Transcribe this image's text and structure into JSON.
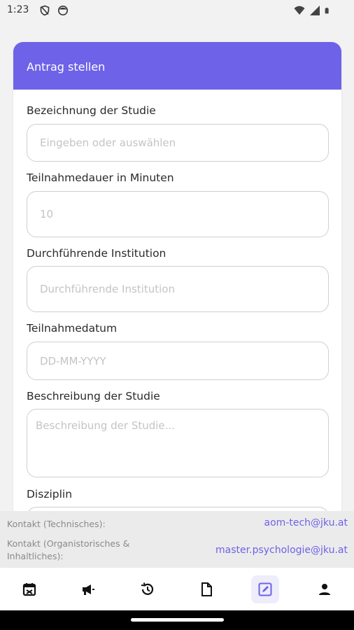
{
  "status_bar": {
    "time": "1:23",
    "icons_left": [
      "shield-slash-icon",
      "face-icon"
    ],
    "icons_right": [
      "wifi-icon",
      "signal-icon",
      "battery-icon"
    ]
  },
  "form": {
    "title": "Antrag stellen",
    "fields": [
      {
        "label": "Bezeichnung der Studie",
        "placeholder": "Eingeben oder auswählen"
      },
      {
        "label": "Teilnahmedauer in Minuten",
        "placeholder": "10"
      },
      {
        "label": "Durchführende Institution",
        "placeholder": "Durchführende Institution"
      },
      {
        "label": "Teilnahmedatum",
        "placeholder": "DD-MM-YYYY"
      },
      {
        "label": "Beschreibung der Studie",
        "placeholder": "Beschreibung der Studie..."
      },
      {
        "label": "Disziplin",
        "placeholder": ""
      }
    ]
  },
  "footer": {
    "contact_technical_label": "Kontakt (Technisches):",
    "contact_technical_email": "aom-tech@jku.at",
    "contact_org_label_line1": "Kontakt (Organistorisches &",
    "contact_org_label_line2": "Inhaltliches):",
    "contact_org_email": "master.psychologie@jku.at"
  },
  "bottom_nav": {
    "items": [
      "calendar-icon",
      "megaphone-icon",
      "history-icon",
      "document-icon",
      "edit-icon",
      "person-icon"
    ],
    "active": "edit-icon"
  },
  "colors": {
    "accent": "#6e62e8",
    "background": "#f2f2f2",
    "card": "#ffffff",
    "footer": "#ebebeb"
  }
}
